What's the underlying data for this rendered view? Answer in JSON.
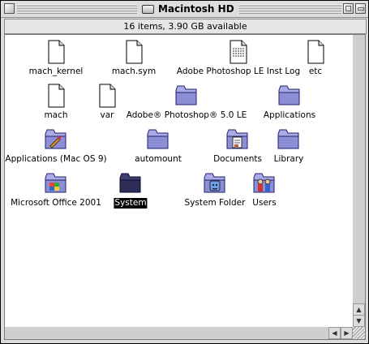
{
  "window": {
    "title": "Macintosh HD",
    "status": "16 items, 3.90 GB available"
  },
  "items": [
    {
      "label": "mach_kernel",
      "icon": "document-icon"
    },
    {
      "label": "mach.sym",
      "icon": "document-icon"
    },
    {
      "label": "Adobe Photoshop LE Inst Log",
      "icon": "text-document-icon"
    },
    {
      "label": "etc",
      "icon": "document-icon"
    },
    {
      "label": "mach",
      "icon": "document-icon"
    },
    {
      "label": "var",
      "icon": "document-icon"
    },
    {
      "label": "Adobe® Photoshop® 5.0 LE",
      "icon": "folder-icon"
    },
    {
      "label": "Applications",
      "icon": "folder-icon"
    },
    {
      "label": "Applications (Mac OS 9)",
      "icon": "applications-folder-icon"
    },
    {
      "label": "automount",
      "icon": "folder-icon"
    },
    {
      "label": "Documents",
      "icon": "documents-folder-icon"
    },
    {
      "label": "Library",
      "icon": "folder-icon"
    },
    {
      "label": "Microsoft Office 2001",
      "icon": "office-folder-icon"
    },
    {
      "label": "System",
      "icon": "system-folder-icon",
      "selected": true
    },
    {
      "label": "System Folder",
      "icon": "mac-os-system-folder-icon"
    },
    {
      "label": "Users",
      "icon": "users-folder-icon"
    }
  ]
}
